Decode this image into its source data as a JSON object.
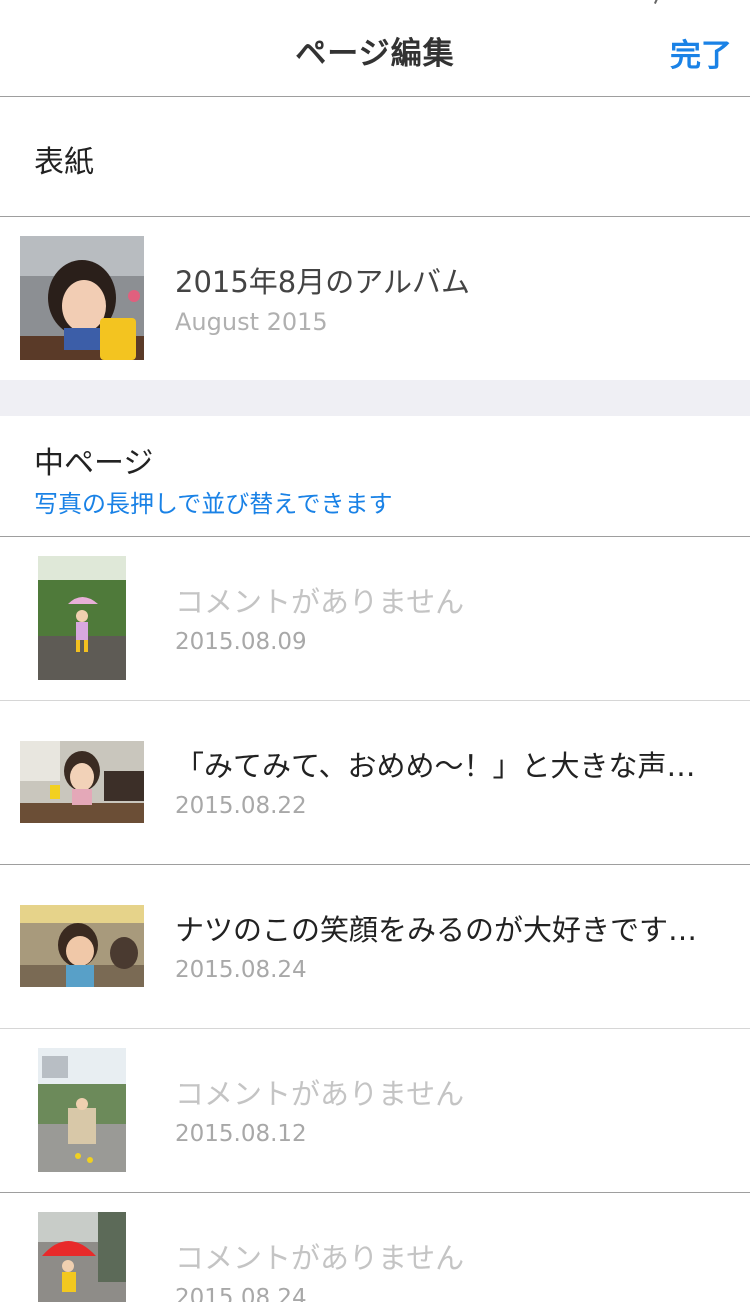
{
  "nav": {
    "title": "ページ編集",
    "done_label": "完了"
  },
  "cover_section": {
    "label": "表紙"
  },
  "cover": {
    "title": "2015年8月のアルバム",
    "subtitle": "August 2015"
  },
  "pages_section": {
    "label": "中ページ",
    "hint": "写真の長押しで並び替えできます"
  },
  "pages": [
    {
      "comment": "コメントがありません",
      "date": "2015.08.09"
    },
    {
      "comment": "「みてみて、おめめ〜！」と大きな声…",
      "date": "2015.08.22"
    },
    {
      "comment": "ナツのこの笑顔をみるのが大好きです…",
      "date": "2015.08.24"
    },
    {
      "comment": "コメントがありません",
      "date": "2015.08.12"
    },
    {
      "comment": "コメントがありません",
      "date": "2015.08.24"
    }
  ]
}
